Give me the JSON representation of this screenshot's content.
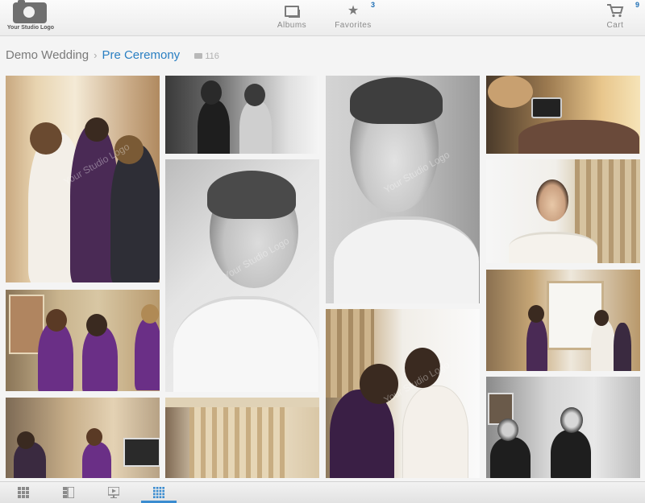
{
  "header": {
    "logo_text": "Your Studio Logo",
    "nav": [
      {
        "label": "Albums",
        "icon": "albums-icon",
        "badge": ""
      },
      {
        "label": "Favorites",
        "icon": "star-icon",
        "badge": "3"
      },
      {
        "label": "Cart",
        "icon": "cart-icon",
        "badge": "9"
      }
    ]
  },
  "breadcrumb": {
    "root": "Demo Wedding",
    "current": "Pre Ceremony",
    "photo_count": "116"
  },
  "photos": [
    {
      "id": "p1",
      "tone": "warm"
    },
    {
      "id": "p2",
      "tone": "bw"
    },
    {
      "id": "p3",
      "tone": "bw"
    },
    {
      "id": "p4",
      "tone": "warm"
    },
    {
      "id": "p5",
      "tone": "bw"
    },
    {
      "id": "p6",
      "tone": "light"
    },
    {
      "id": "p7",
      "tone": "warm"
    },
    {
      "id": "p8",
      "tone": "light"
    },
    {
      "id": "p9",
      "tone": "warm"
    },
    {
      "id": "p10",
      "tone": "warm"
    },
    {
      "id": "p11",
      "tone": "warm"
    },
    {
      "id": "p12",
      "tone": "bw"
    }
  ],
  "watermark": "Your Studio Logo",
  "colors": {
    "accent": "#2a7fc2",
    "badge": "#1f6fb5",
    "background": "#f4f4f4"
  },
  "view_modes": [
    {
      "name": "grid-large-icon",
      "active": false
    },
    {
      "name": "list-icon",
      "active": false
    },
    {
      "name": "slideshow-icon",
      "active": false
    },
    {
      "name": "grid-small-icon",
      "active": true
    }
  ]
}
